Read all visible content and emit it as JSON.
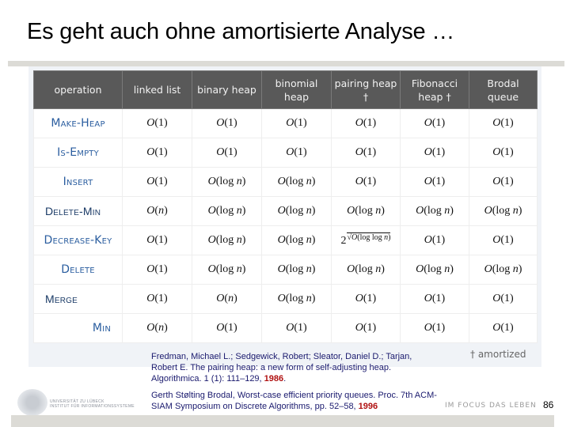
{
  "slide": {
    "title": "Es geht auch ohne amortisierte Analyse …",
    "page_number": "86"
  },
  "table": {
    "headers": [
      "operation",
      "linked list",
      "binary heap",
      "binomial heap",
      "pairing heap †",
      "Fibonacci heap †",
      "Brodal queue"
    ],
    "rows": [
      {
        "op": "Make-Heap",
        "cells": [
          "O(1)",
          "O(1)",
          "O(1)",
          "O(1)",
          "O(1)",
          "O(1)"
        ]
      },
      {
        "op": "Is-Empty",
        "cells": [
          "O(1)",
          "O(1)",
          "O(1)",
          "O(1)",
          "O(1)",
          "O(1)"
        ]
      },
      {
        "op": "Insert",
        "cells": [
          "O(1)",
          "O(log n)",
          "O(log n)",
          "O(1)",
          "O(1)",
          "O(1)"
        ]
      },
      {
        "op": "Delete-Min",
        "cells": [
          "O(n)",
          "O(log n)",
          "O(log n)",
          "O(log n)",
          "O(log n)",
          "O(log n)"
        ]
      },
      {
        "op": "Decrease-Key",
        "cells": [
          "O(1)",
          "O(log n)",
          "O(log n)",
          "2^√O(log log n)",
          "O(1)",
          "O(1)"
        ]
      },
      {
        "op": "Delete",
        "cells": [
          "O(1)",
          "O(log n)",
          "O(log n)",
          "O(log n)",
          "O(log n)",
          "O(log n)"
        ]
      },
      {
        "op": "Merge",
        "cells": [
          "O(1)",
          "O(n)",
          "O(log n)",
          "O(1)",
          "O(1)",
          "O(1)"
        ]
      },
      {
        "op": "Min",
        "cells": [
          "O(n)",
          "O(1)",
          "O(1)",
          "O(1)",
          "O(1)",
          "O(1)"
        ]
      }
    ],
    "footnote": "† amortized"
  },
  "references": [
    {
      "text": "Fredman, Michael L.; Sedgewick, Robert; Sleator, Daniel D.; Tarjan, Robert E. The pairing heap: a new form of self-adjusting heap. Algorithmica. 1 (1): 111–129, ",
      "year": "1986",
      "suffix": "."
    },
    {
      "text": "Gerth Stølting Brodal, Worst-case efficient priority queues. Proc. 7th ACM-SIAM Symposium on Discrete Algorithms, pp. 52–58, ",
      "year": "1996",
      "suffix": ""
    }
  ],
  "footer": {
    "university": "UNIVERSITÄT ZU LÜBECK",
    "institute": "INSTITUT FÜR INFORMATIONSSYSTEME",
    "slogan": "IM FOCUS DAS LEBEN"
  }
}
